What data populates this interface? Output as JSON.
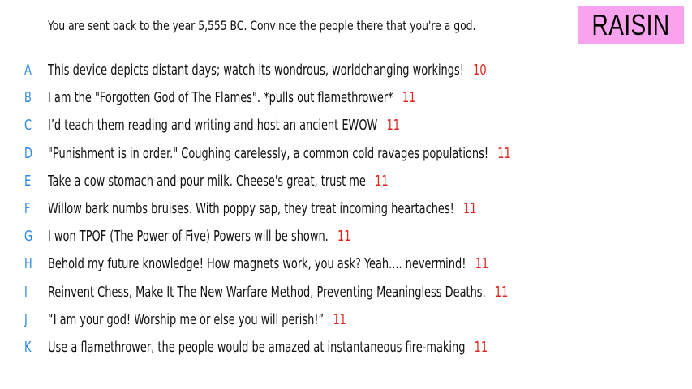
{
  "prompt": "You are sent back to the year 5,555 BC. Convince the people there that you're a god.",
  "badge": "RAISIN",
  "colors": {
    "badge_bg": "#f9a2ee",
    "letter": "#2f8ae5",
    "score": "#e0241b"
  },
  "entries": [
    {
      "letter": "A",
      "text": "This device depicts distant days; watch its wondrous, worldchanging workings!",
      "score": "10"
    },
    {
      "letter": "B",
      "text": "I am the \"Forgotten God of The Flames\". *pulls out flamethrower*",
      "score": "11"
    },
    {
      "letter": "C",
      "text": "I’d teach them reading and writing and host an ancient EWOW",
      "score": "11"
    },
    {
      "letter": "D",
      "text": "\"Punishment is in order.\" Coughing carelessly, a common cold ravages populations!",
      "score": "11"
    },
    {
      "letter": "E",
      "text": "Take a cow stomach and pour milk. Cheese's great, trust me",
      "score": "11"
    },
    {
      "letter": "F",
      "text": "Willow bark numbs bruises. With poppy sap, they treat incoming heartaches!",
      "score": "11"
    },
    {
      "letter": "G",
      "text": "I won TPOF (The Power of Five) Powers will be shown.",
      "score": "11"
    },
    {
      "letter": "H",
      "text": "Behold my future knowledge! How magnets work, you ask? Yeah.... nevermind!",
      "score": "11"
    },
    {
      "letter": "I",
      "text": "Reinvent Chess, Make It The New Warfare Method, Preventing Meaningless Deaths.",
      "score": "11"
    },
    {
      "letter": "J",
      "text": "“I am your god! Worship me or else you will perish!”",
      "score": "11"
    },
    {
      "letter": "K",
      "text": "Use a flamethrower, the people would be amazed at instantaneous fire-making",
      "score": "11"
    }
  ]
}
